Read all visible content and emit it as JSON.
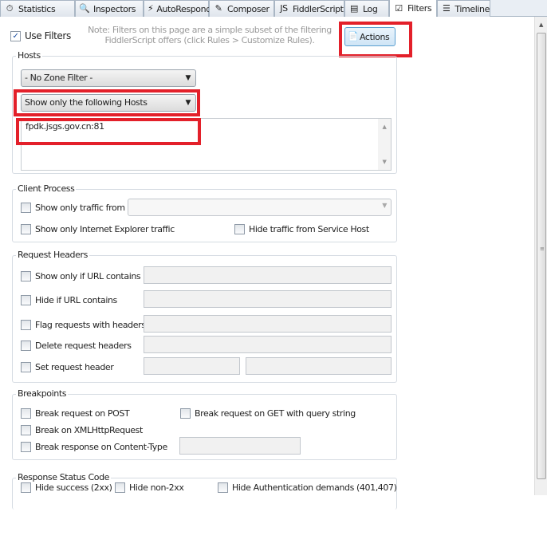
{
  "tabs": [
    {
      "label": "Statistics",
      "icon": "stopwatch-icon"
    },
    {
      "label": "Inspectors",
      "icon": "magnifier-icon"
    },
    {
      "label": "AutoResponder",
      "icon": "lightning-icon"
    },
    {
      "label": "Composer",
      "icon": "pencil-icon"
    },
    {
      "label": "FiddlerScript",
      "icon": "script-icon"
    },
    {
      "label": "Log",
      "icon": "log-icon"
    },
    {
      "label": "Filters",
      "icon": "checkbox-icon",
      "active": true
    },
    {
      "label": "Timeline",
      "icon": "timeline-icon"
    }
  ],
  "use_filters": {
    "label": "Use Filters",
    "checked": true
  },
  "note": "Note: Filters on this page are a simple subset of the filtering FiddlerScript offers (click Rules > Customize Rules).",
  "actions_label": "Actions",
  "hosts": {
    "title": "Hosts",
    "zone_filter": "- No Zone Filter -",
    "host_filter": "Show only the following Hosts",
    "host_list": "fpdk.jsgs.gov.cn:81"
  },
  "client": {
    "title": "Client Process",
    "show_from": "Show only traffic from",
    "ie": "Show only Internet Explorer traffic",
    "service_host": "Hide traffic from Service Host"
  },
  "request": {
    "title": "Request Headers",
    "items": [
      "Show only if URL contains",
      "Hide if URL contains",
      "Flag requests with headers",
      "Delete request headers",
      "Set request header"
    ]
  },
  "breakpoints": {
    "title": "Breakpoints",
    "post": "Break request on POST",
    "get": "Break request on GET with query string",
    "xhr": "Break on XMLHttpRequest",
    "content_type": "Break response on Content-Type"
  },
  "response": {
    "title": "Response Status Code",
    "success": "Hide success (2xx)",
    "non2xx": "Hide non-2xx",
    "auth": "Hide Authentication demands (401,407)"
  },
  "highlight_color": "#e3202a"
}
